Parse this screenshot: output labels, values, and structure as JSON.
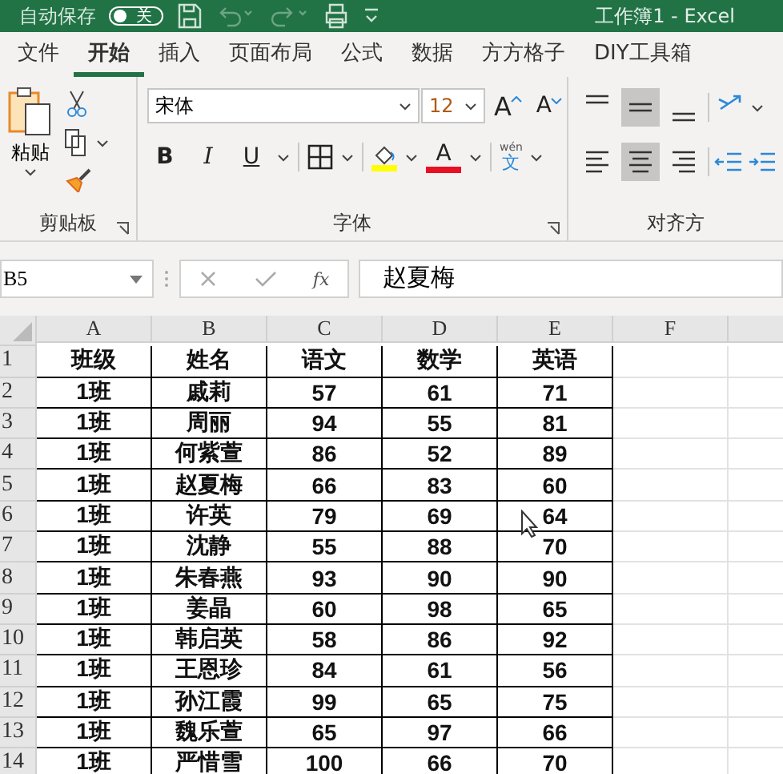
{
  "title_bar": {
    "autosave_label": "自动保存",
    "autosave_toggle": {
      "label": "关",
      "on": false
    },
    "title": "工作簿1 - Excel"
  },
  "ribbon_tabs": [
    {
      "label": "文件",
      "selected": false
    },
    {
      "label": "开始",
      "selected": true
    },
    {
      "label": "插入",
      "selected": false
    },
    {
      "label": "页面布局",
      "selected": false
    },
    {
      "label": "公式",
      "selected": false
    },
    {
      "label": "数据",
      "selected": false
    },
    {
      "label": "方方格子",
      "selected": false
    },
    {
      "label": "DIY工具箱",
      "selected": false
    }
  ],
  "clipboard": {
    "paste_label": "粘贴",
    "group_label": "剪贴板"
  },
  "font": {
    "font_name": "宋体",
    "font_size": "12",
    "grow_label": "A",
    "shrink_label": "A",
    "bold": "B",
    "italic": "I",
    "underline": "U",
    "font_color_label": "A",
    "phonetic_ruby": "wén",
    "phonetic_char": "文",
    "group_label": "字体"
  },
  "alignment": {
    "vertical": [
      {
        "kind": "top",
        "selected": false
      },
      {
        "kind": "middle",
        "selected": true
      },
      {
        "kind": "bottom",
        "selected": false
      }
    ],
    "horizontal": [
      {
        "kind": "left",
        "selected": false
      },
      {
        "kind": "center",
        "selected": true
      },
      {
        "kind": "right",
        "selected": false
      }
    ],
    "group_label": "对齐方"
  },
  "formula_bar": {
    "name_box": "B5",
    "function_label": "fx",
    "formula": "赵夏梅"
  },
  "sheet": {
    "columns": [
      "A",
      "B",
      "C",
      "D",
      "E",
      "F"
    ],
    "rows": [
      {
        "header": "1",
        "cells": [
          "班级",
          "姓名",
          "语文",
          "数学",
          "英语"
        ]
      },
      {
        "header": "2",
        "cells": [
          "1班",
          "戚莉",
          "57",
          "61",
          "71"
        ]
      },
      {
        "header": "3",
        "cells": [
          "1班",
          "周丽",
          "94",
          "55",
          "81"
        ]
      },
      {
        "header": "4",
        "cells": [
          "1班",
          "何紫萱",
          "86",
          "52",
          "89"
        ]
      },
      {
        "header": "5",
        "cells": [
          "1班",
          "赵夏梅",
          "66",
          "83",
          "60"
        ]
      },
      {
        "header": "6",
        "cells": [
          "1班",
          "许英",
          "79",
          "69",
          "64"
        ]
      },
      {
        "header": "7",
        "cells": [
          "1班",
          "沈静",
          "55",
          "88",
          "70"
        ]
      },
      {
        "header": "8",
        "cells": [
          "1班",
          "朱春燕",
          "93",
          "90",
          "90"
        ]
      },
      {
        "header": "9",
        "cells": [
          "1班",
          "姜晶",
          "60",
          "98",
          "65"
        ]
      },
      {
        "header": "10",
        "cells": [
          "1班",
          "韩启英",
          "58",
          "86",
          "92"
        ]
      },
      {
        "header": "11",
        "cells": [
          "1班",
          "王恩珍",
          "84",
          "61",
          "56"
        ]
      },
      {
        "header": "12",
        "cells": [
          "1班",
          "孙江霞",
          "99",
          "65",
          "75"
        ]
      },
      {
        "header": "13",
        "cells": [
          "1班",
          "魏乐萱",
          "65",
          "97",
          "66"
        ]
      },
      {
        "header": "14",
        "cells": [
          "1班",
          "严惜雪",
          "100",
          "66",
          "70"
        ]
      }
    ]
  }
}
